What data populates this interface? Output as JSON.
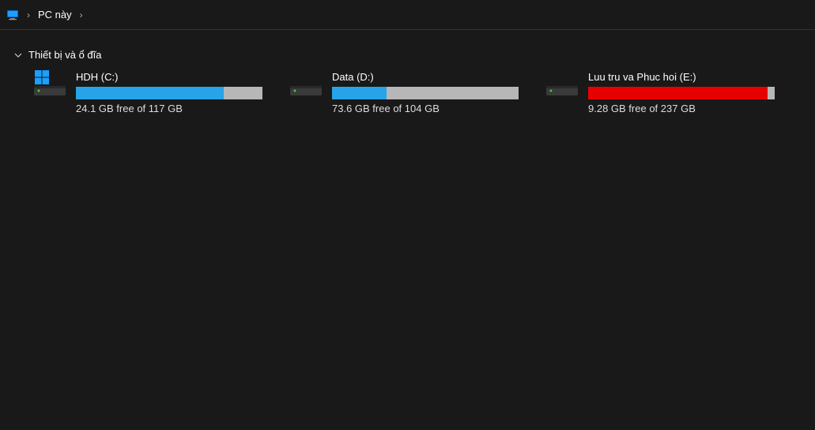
{
  "breadcrumb": {
    "root_label": "PC này"
  },
  "section": {
    "title": "Thiết bị và ổ đĩa"
  },
  "drives": [
    {
      "id": "c",
      "name": "HDH (C:)",
      "free_text": "24.1 GB free of 117 GB",
      "used_fraction": 0.794,
      "fill_color": "#27a4e8",
      "os": true
    },
    {
      "id": "d",
      "name": "Data (D:)",
      "free_text": "73.6 GB free of 104 GB",
      "used_fraction": 0.292,
      "fill_color": "#27a4e8",
      "os": false
    },
    {
      "id": "e",
      "name": "Luu tru va Phuc hoi (E:)",
      "free_text": "9.28 GB free of 237 GB",
      "used_fraction": 0.961,
      "fill_color": "#e60000",
      "os": false
    }
  ]
}
